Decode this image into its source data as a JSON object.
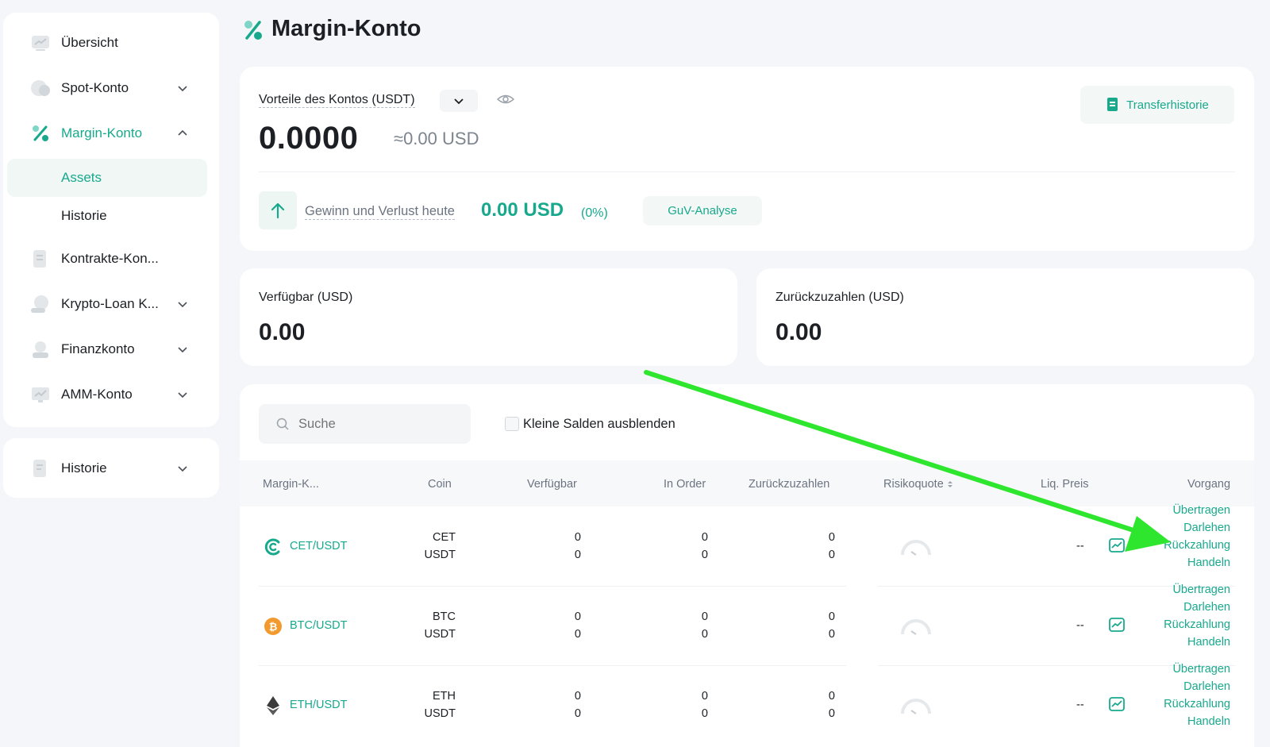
{
  "sidebar": {
    "items": [
      {
        "label": "Übersicht",
        "icon": "overview-icon"
      },
      {
        "label": "Spot-Konto",
        "icon": "spot-icon"
      },
      {
        "label": "Margin-Konto",
        "icon": "margin-icon"
      },
      {
        "label": "Kontrakte-Kon...",
        "icon": "contract-icon"
      },
      {
        "label": "Krypto-Loan K...",
        "icon": "loan-icon"
      },
      {
        "label": "Finanzkonto",
        "icon": "finance-icon"
      },
      {
        "label": "AMM-Konto",
        "icon": "amm-icon"
      }
    ],
    "sub_items": [
      "Assets",
      "Historie"
    ],
    "history_label": "Historie"
  },
  "page": {
    "title": "Margin-Konto"
  },
  "account": {
    "label": "Vorteile des Kontos (USDT)",
    "value": "0.0000",
    "approx": "≈0.00 USD",
    "pnl_label": "Gewinn und Verlust heute",
    "pnl_value": "0.00 USD",
    "pnl_pct": "(0%)",
    "pnl_button": "GuV-Analyse",
    "transfer_history": "Transferhistorie"
  },
  "available": {
    "label": "Verfügbar (USD)",
    "value": "0.00"
  },
  "repay": {
    "label": "Zurückzuzahlen (USD)",
    "value": "0.00"
  },
  "filters": {
    "search_placeholder": "Suche",
    "hide_small": "Kleine Salden ausblenden"
  },
  "table": {
    "headers": [
      "Margin-K...",
      "Coin",
      "Verfügbar",
      "In Order",
      "Zurückzuzahlen",
      "Risikoquote",
      "Liq. Preis",
      "Vorgang"
    ],
    "actions": [
      "Übertragen",
      "Darlehen",
      "Rückzahlung",
      "Handeln"
    ],
    "rows": [
      {
        "pair": "CET/USDT",
        "coins": [
          "CET",
          "USDT"
        ],
        "available": [
          "0",
          "0"
        ],
        "in_order": [
          "0",
          "0"
        ],
        "repay": [
          "0",
          "0"
        ],
        "liq": "--",
        "icon": "coinex-icon",
        "color": "#18a98d"
      },
      {
        "pair": "BTC/USDT",
        "coins": [
          "BTC",
          "USDT"
        ],
        "available": [
          "0",
          "0"
        ],
        "in_order": [
          "0",
          "0"
        ],
        "repay": [
          "0",
          "0"
        ],
        "liq": "--",
        "icon": "bitcoin-icon",
        "color": "#f29a2e"
      },
      {
        "pair": "ETH/USDT",
        "coins": [
          "ETH",
          "USDT"
        ],
        "available": [
          "0",
          "0"
        ],
        "in_order": [
          "0",
          "0"
        ],
        "repay": [
          "0",
          "0"
        ],
        "liq": "--",
        "icon": "ethereum-icon",
        "color": "#3c3c3d"
      }
    ]
  },
  "colors": {
    "accent": "#18a98d",
    "annotation_arrow": "#2ee62e"
  }
}
